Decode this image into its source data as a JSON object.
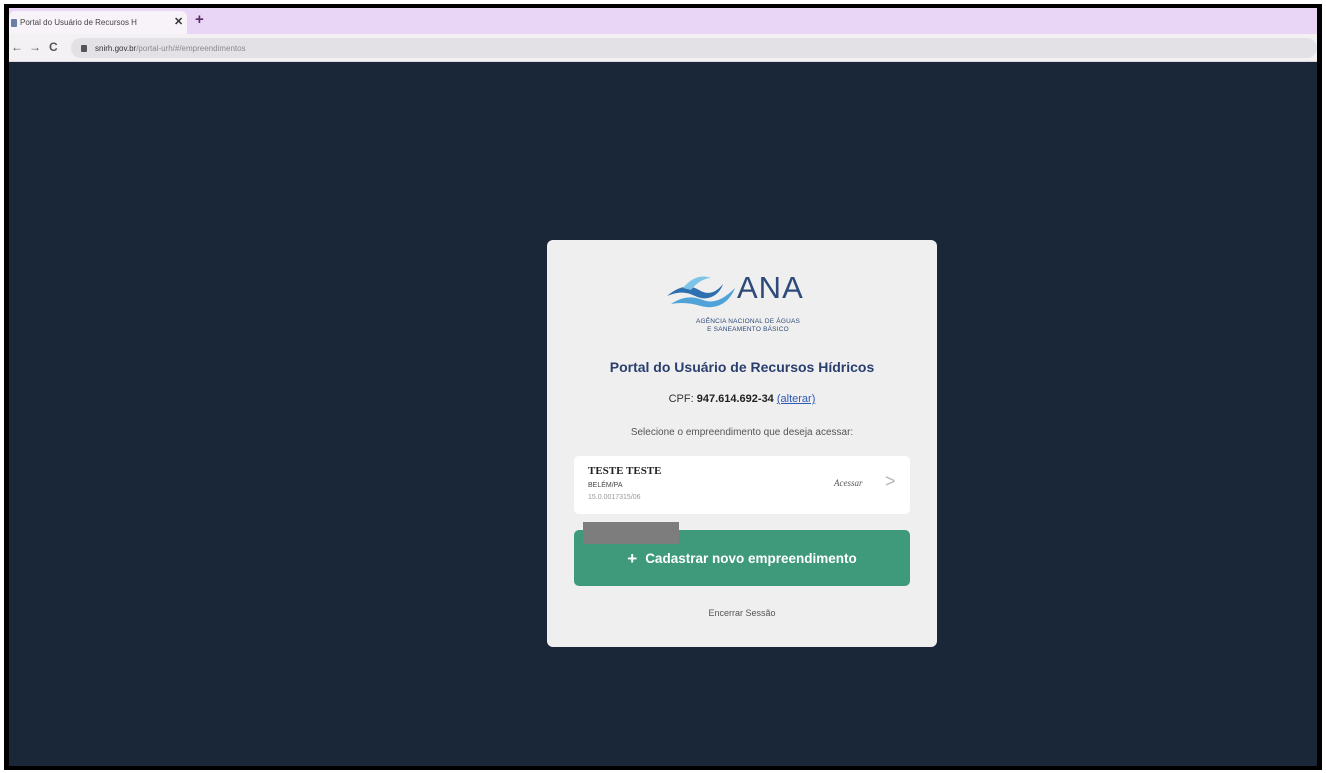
{
  "browser": {
    "tab_title": "Portal do Usuário de Recursos H",
    "tab_close": "✕",
    "new_tab": "+",
    "back": "←",
    "forward": "→",
    "reload": "C",
    "url_host": "snirh.gov.br",
    "url_path": "/portal-urh/#/empreendimentos"
  },
  "logo": {
    "word": "ANA",
    "line1": "AGÊNCIA NACIONAL DE ÁGUAS",
    "line2": "E SANEAMENTO BÁSICO"
  },
  "portal_title": "Portal do Usuário de Recursos Hídricos",
  "cpf": {
    "label": "CPF:",
    "value": "947.614.692-34",
    "change_link": "(alterar)"
  },
  "select_label": "Selecione o empreendimento que deseja acessar:",
  "empreendimento": {
    "name": "TESTE TESTE",
    "city": "BELÉM/PA",
    "code": "15.0.0017315/06",
    "access_label": "Acessar",
    "chevron": ">"
  },
  "new_button": {
    "icon": "+",
    "label": "Cadastrar novo empreendimento"
  },
  "logout_label": "Encerrar Sessão",
  "colors": {
    "background": "#1a2739",
    "card": "#efefef",
    "primary_button": "#3f9a7b",
    "title": "#2a3f6e",
    "link": "#2d5ab8",
    "tabstrip": "#e9d5f6"
  }
}
